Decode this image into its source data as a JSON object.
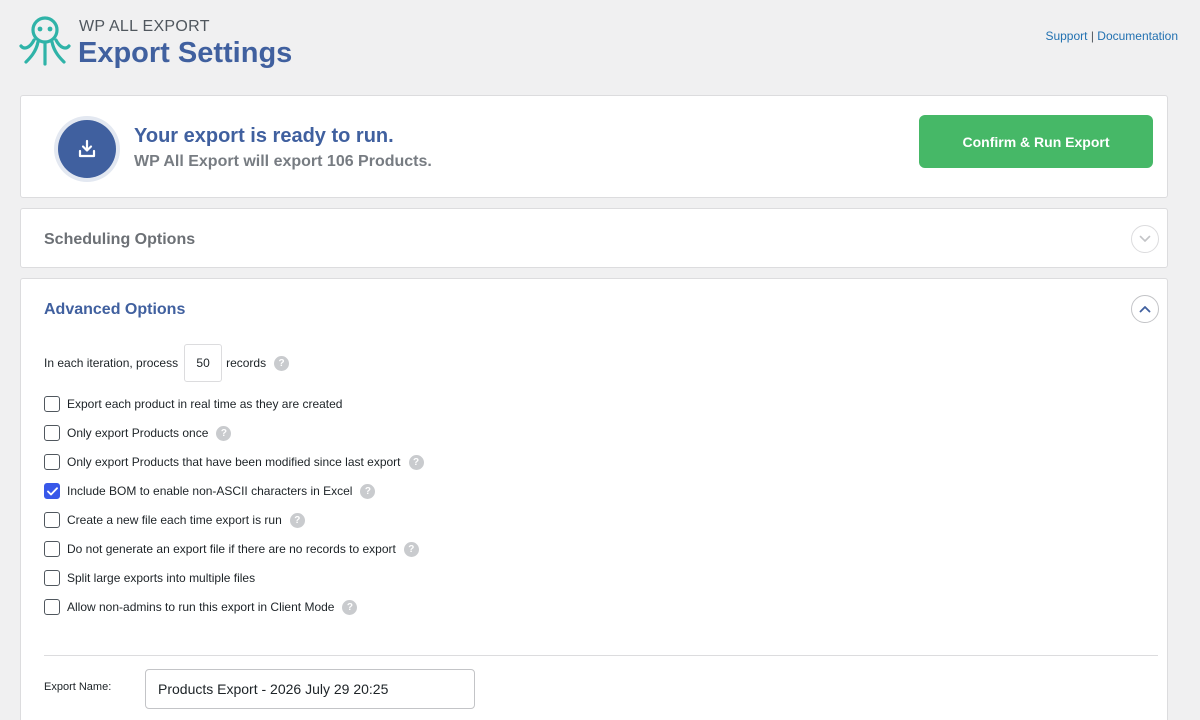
{
  "header": {
    "brand": "WP ALL EXPORT",
    "title": "Export Settings",
    "links": {
      "support": "Support",
      "separator": "|",
      "documentation": "Documentation"
    }
  },
  "ready_panel": {
    "icon": "download-icon",
    "title": "Your export is ready to run.",
    "subtitle": "WP All Export will export 106 Products.",
    "run_button": "Confirm & Run Export"
  },
  "scheduling": {
    "title": "Scheduling Options",
    "toggle_icon": "chevron-down-icon"
  },
  "advanced": {
    "title": "Advanced Options",
    "toggle_icon": "chevron-up-icon",
    "iteration": {
      "prefix": "In each iteration, process",
      "value": "50",
      "suffix": "records"
    },
    "options": [
      {
        "label": "Export each product in real time as they are created",
        "checked": false,
        "help": false
      },
      {
        "label": "Only export Products once",
        "checked": false,
        "help": true
      },
      {
        "label": "Only export Products that have been modified since last export",
        "checked": false,
        "help": true
      },
      {
        "label": "Include BOM to enable non-ASCII characters in Excel",
        "checked": true,
        "help": true
      },
      {
        "label": "Create a new file each time export is run",
        "checked": false,
        "help": true
      },
      {
        "label": "Do not generate an export file if there are no records to export",
        "checked": false,
        "help": true
      },
      {
        "label": "Split large exports into multiple files",
        "checked": false,
        "help": false
      },
      {
        "label": "Allow non-admins to run this export in Client Mode",
        "checked": false,
        "help": true
      }
    ],
    "help_glyph": "?",
    "export_name_label": "Export Name:",
    "export_name_value": "Products Export - 2026 July 29 20:25"
  },
  "colors": {
    "brand_blue": "#40609f",
    "run_green": "#46b867",
    "checkbox_blue": "#3858e9",
    "link_blue": "#2271b1"
  }
}
